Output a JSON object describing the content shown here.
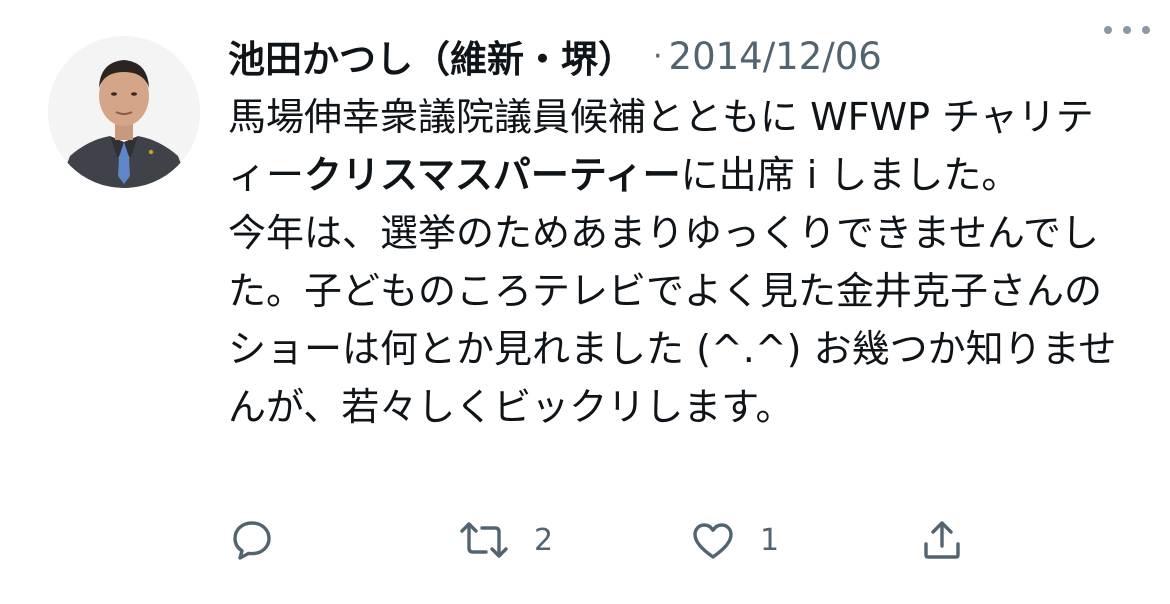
{
  "tweet": {
    "author": {
      "name": "池田かつし（維新・堺）",
      "avatar_icon": "person-portrait-icon"
    },
    "separator": "·",
    "date": "2014/12/06",
    "more_icon": "more-icon",
    "body": {
      "p1_seg1": "馬場伸幸衆議院議員候補とともに WFWP チャリティー",
      "p1_bold": "クリスマスパーティー",
      "p1_seg2": "に出席 i しました。",
      "p2": "今年は、選挙のためあまりゆっくりできませんでした。子どものころテレビでよく見た金井克子さんのショーは何とか見れました (^.^) お幾つか知りませんが、若々しくビックリします。"
    },
    "actions": {
      "reply": {
        "icon": "reply-icon",
        "count": ""
      },
      "retweet": {
        "icon": "retweet-icon",
        "count": "2"
      },
      "like": {
        "icon": "heart-icon",
        "count": "1"
      },
      "share": {
        "icon": "share-icon",
        "count": ""
      }
    }
  },
  "colors": {
    "text": "#0f1419",
    "secondary": "#536471",
    "background": "#ffffff"
  }
}
